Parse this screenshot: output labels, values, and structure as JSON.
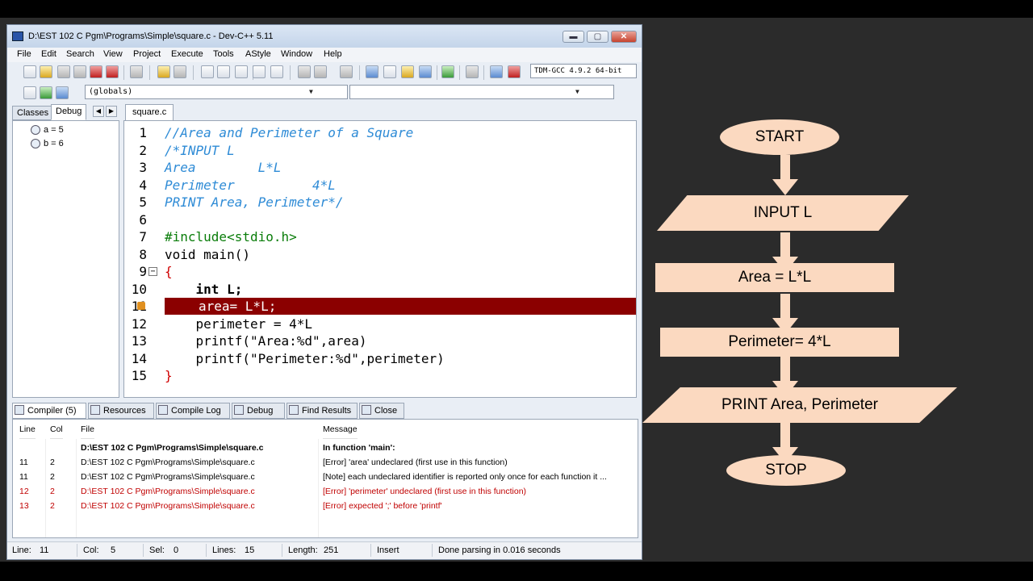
{
  "window": {
    "title": "D:\\EST 102 C Pgm\\Programs\\Simple\\square.c - Dev-C++ 5.11",
    "min": "▬",
    "max": "▢",
    "close": "✕"
  },
  "menu": [
    "File",
    "Edit",
    "Search",
    "View",
    "Project",
    "Execute",
    "Tools",
    "AStyle",
    "Window",
    "Help"
  ],
  "compiler_select": "TDM-GCC 4.9.2 64-bit",
  "globals_select": "(globals)",
  "left_tabs": [
    "Classes",
    "Debug"
  ],
  "watches": [
    "a = 5",
    "b = 6"
  ],
  "editor_tab": "square.c",
  "code_lines": [
    {
      "n": "1",
      "text": "//Area and Perimeter of a Square"
    },
    {
      "n": "2",
      "text": "/*INPUT L"
    },
    {
      "n": "3",
      "text": "Area        L*L"
    },
    {
      "n": "4",
      "text": "Perimeter          4*L"
    },
    {
      "n": "5",
      "text": "PRINT Area, Perimeter*/"
    },
    {
      "n": "6",
      "text": ""
    },
    {
      "n": "7",
      "text": "#include<stdio.h>"
    },
    {
      "n": "8",
      "text": "void main()"
    },
    {
      "n": "9",
      "text": "{"
    },
    {
      "n": "10",
      "text": "    int L;"
    },
    {
      "n": "11",
      "text": "area= L*L;"
    },
    {
      "n": "12",
      "text": "    perimeter = 4*L"
    },
    {
      "n": "13",
      "text": "    printf(\"Area:%d\",area)"
    },
    {
      "n": "14",
      "text": "    printf(\"Perimeter:%d\",perimeter)"
    },
    {
      "n": "15",
      "text": "}"
    }
  ],
  "bottom_tabs": [
    "Compiler (5)",
    "Resources",
    "Compile Log",
    "Debug",
    "Find Results",
    "Close"
  ],
  "results_headers": {
    "line": "Line",
    "col": "Col",
    "file": "File",
    "message": "Message"
  },
  "results_rows": [
    {
      "line": "",
      "col": "",
      "file": "D:\\EST 102 C Pgm\\Programs\\Simple\\square.c",
      "message": "In function 'main':"
    },
    {
      "line": "11",
      "col": "2",
      "file": "D:\\EST 102 C Pgm\\Programs\\Simple\\square.c",
      "message": "[Error] 'area' undeclared (first use in this function)"
    },
    {
      "line": "11",
      "col": "2",
      "file": "D:\\EST 102 C Pgm\\Programs\\Simple\\square.c",
      "message": "[Note] each undeclared identifier is reported only once for each function it ..."
    },
    {
      "line": "12",
      "col": "2",
      "file": "D:\\EST 102 C Pgm\\Programs\\Simple\\square.c",
      "message": "[Error] 'perimeter' undeclared (first use in this function)"
    },
    {
      "line": "13",
      "col": "2",
      "file": "D:\\EST 102 C Pgm\\Programs\\Simple\\square.c",
      "message": "[Error] expected ';' before 'printf'"
    }
  ],
  "status": {
    "line_label": "Line:",
    "line_val": "11",
    "col_label": "Col:",
    "col_val": "5",
    "sel_label": "Sel:",
    "sel_val": "0",
    "lines_label": "Lines:",
    "lines_val": "15",
    "length_label": "Length:",
    "length_val": "251",
    "mode": "Insert",
    "message": "Done parsing in 0.016 seconds"
  },
  "flowchart": {
    "start": "START",
    "input": "INPUT L",
    "area": "Area = L*L",
    "perimeter": "Perimeter= 4*L",
    "print": "PRINT Area, Perimeter",
    "stop": "STOP",
    "fill_color": "#fbd9c0"
  }
}
